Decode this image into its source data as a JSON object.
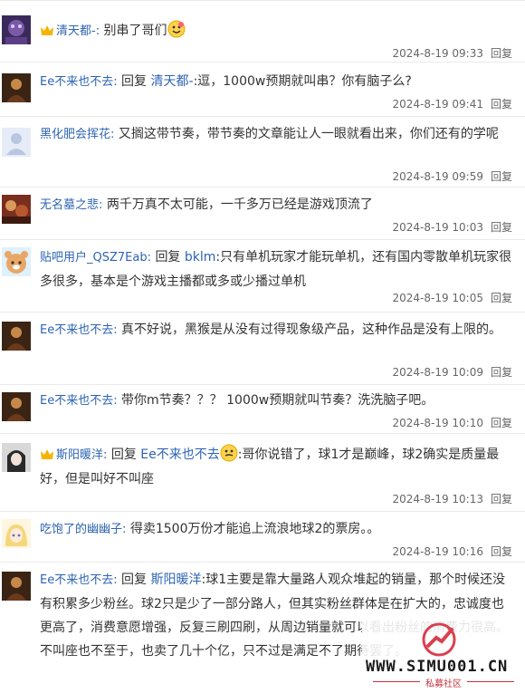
{
  "replies": [
    {
      "user": "清天都-:",
      "vip": true,
      "text": "别串了哥们",
      "emoji": "smiley-emoji",
      "time": "2024-8-19 09:33",
      "reply_label": "回复"
    },
    {
      "user": "Ee不来也不去:",
      "prefix": "回复",
      "at": "清天都-",
      "text": ":逗，1000w预期就叫串？你有脑子么?",
      "time": "2024-8-19 09:41",
      "reply_label": "回复"
    },
    {
      "user": "黑化肥会挥花:",
      "text": "又搁这带节奏，带节奏的文章能让人一眼就看出来，你们还有的学呢",
      "time": "2024-8-19 09:59",
      "reply_label": "回复"
    },
    {
      "user": "无名墓之悲:",
      "text": "两千万真不太可能，一千多万已经是游戏顶流了",
      "time": "2024-8-19 10:03",
      "reply_label": "回复"
    },
    {
      "user": "贴吧用户_QSZ7Eab:",
      "prefix": "回复",
      "at": "bklm",
      "text": ":只有单机玩家才能玩单机，还有国内零散单机玩家很多很多，基本是个游戏主播都或多或少播过单机",
      "time": "2024-8-19 10:05",
      "reply_label": "回复"
    },
    {
      "user": "Ee不来也不去:",
      "text": "真不好说，黑猴是从没有过得现象级产品，这种作品是没有上限的。",
      "time": "2024-8-19 10:09",
      "reply_label": "回复"
    },
    {
      "user": "Ee不来也不去:",
      "text": "带你m节奏？？？ 1000w预期就叫节奏？洗洗脑子吧。",
      "time": "2024-8-19 10:10",
      "reply_label": "回复"
    },
    {
      "user": "斯阳暖洋:",
      "vip": true,
      "prefix": "回复",
      "at": "Ee不来也不去",
      "text": ":哥你说错了，球1才是巅峰，球2确实是质量最好，但是叫好不叫座",
      "emoji": "smiley-emoji",
      "time": "2024-8-19 10:13",
      "reply_label": "回复"
    },
    {
      "user": "吃饱了的幽幽子:",
      "text": "得卖1500万份才能追上流浪地球2的票房。。",
      "time": "2024-8-19 10:16",
      "reply_label": "回复"
    },
    {
      "user": "Ee不来也不去:",
      "prefix": "回复",
      "at": "斯阳暖洋",
      "text": ":球1主要是靠大量路人观众堆起的销量，那个时候还没有积累多少粉丝。球2只是少了一部分路人，但其实粉丝群体是在扩大的，忠诚度也更高了，消费意愿增强，反复三刷四刷，从周边销量就可以看出粉丝的消费力很高。不叫座也不至于，也卖了几十个亿，只不过是满足不了期待罢了。"
    }
  ],
  "watermark": {
    "site": "WWW.SIMU001.CN",
    "sub": "私募社区"
  },
  "colors": {
    "link": "#2d64b3",
    "meta": "#666666",
    "accent": "#c8323c"
  }
}
